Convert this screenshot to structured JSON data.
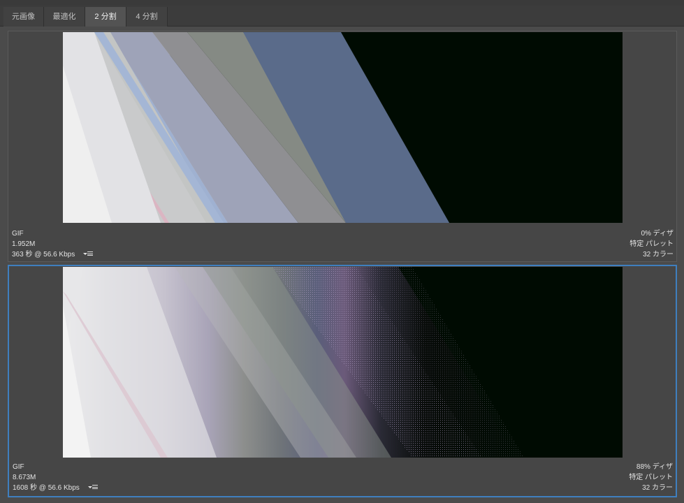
{
  "tabs": [
    {
      "label": "元画像",
      "active": false
    },
    {
      "label": "最適化",
      "active": false
    },
    {
      "label": "2 分割",
      "active": true
    },
    {
      "label": "4 分割",
      "active": false
    }
  ],
  "panes": [
    {
      "format": "GIF",
      "size": "1.952M",
      "download_time": "363 秒 @ 56.6 Kbps",
      "dither": "0% ディザ",
      "palette": "特定 パレット",
      "colors": "32 カラー",
      "selected": false
    },
    {
      "format": "GIF",
      "size": "8.673M",
      "download_time": "1608 秒 @ 56.6 Kbps",
      "dither": "88% ディザ",
      "palette": "特定 パレット",
      "colors": "32 カラー",
      "selected": true
    }
  ],
  "colors": {
    "background": "#4b4b4b",
    "tab_active": "#535353",
    "selection_border": "#3f7fbf",
    "image_dark": "#000b02"
  }
}
